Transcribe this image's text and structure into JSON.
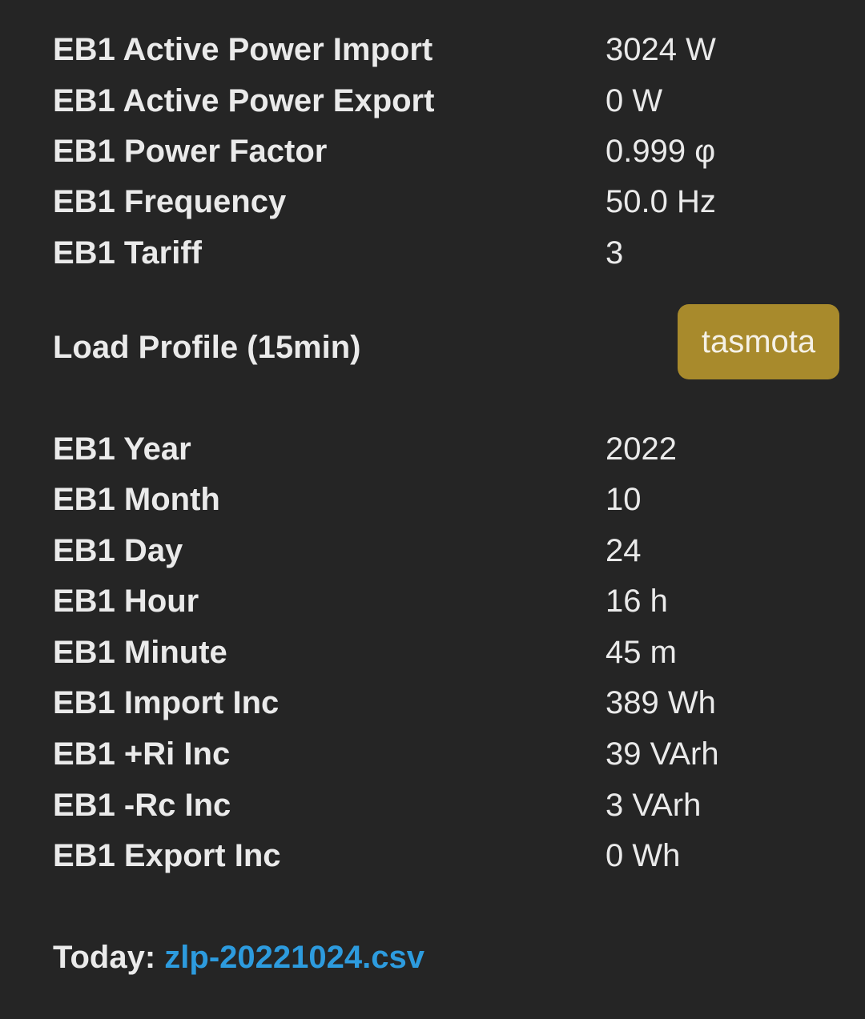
{
  "top_table": [
    {
      "label": "EB1 Active Power Import",
      "value": "3024 W"
    },
    {
      "label": "EB1 Active Power Export",
      "value": "0 W"
    },
    {
      "label": "EB1 Power Factor",
      "value": "0.999 φ"
    },
    {
      "label": "EB1 Frequency",
      "value": "50.0 Hz"
    },
    {
      "label": "EB1 Tariff",
      "value": "3"
    }
  ],
  "load_profile": {
    "title": "Load Profile (15min)",
    "button_label": "tasmota"
  },
  "profile_table": [
    {
      "label": "EB1 Year",
      "value": "2022"
    },
    {
      "label": "EB1 Month",
      "value": "10"
    },
    {
      "label": "EB1 Day",
      "value": "24"
    },
    {
      "label": "EB1 Hour",
      "value": "16 h"
    },
    {
      "label": "EB1 Minute",
      "value": "45 m"
    },
    {
      "label": "EB1 Import Inc",
      "value": "389 Wh"
    },
    {
      "label": "EB1 +Ri Inc",
      "value": "39 VArh"
    },
    {
      "label": "EB1 -Rc Inc",
      "value": "3 VArh"
    },
    {
      "label": "EB1 Export Inc",
      "value": "0 Wh"
    }
  ],
  "today": {
    "label": "Today:",
    "link_text": "zlp-20221024.csv"
  },
  "colors": {
    "background": "#252525",
    "text": "#eaeaea",
    "button": "#a88a2c",
    "link": "#2d9bde"
  }
}
